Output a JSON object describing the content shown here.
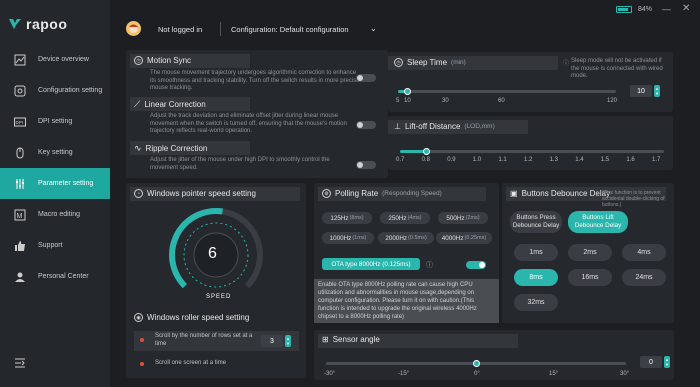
{
  "app": {
    "name": "rapoo",
    "battery": "84%",
    "battery_level": 0.84
  },
  "colors": {
    "accent": "#2ab6ad",
    "sidebar_bg": "#24272b",
    "panel_bg": "#2b2e33"
  },
  "sidebar": {
    "items": [
      {
        "label": "Device overview",
        "icon": "chart-icon"
      },
      {
        "label": "Configuration setting",
        "icon": "config-icon"
      },
      {
        "label": "DPI setting",
        "icon": "dpi-icon"
      },
      {
        "label": "Key setting",
        "icon": "mouse-icon"
      },
      {
        "label": "Parameter setting",
        "icon": "sliders-icon"
      },
      {
        "label": "Macro editing",
        "icon": "macro-icon"
      },
      {
        "label": "Support",
        "icon": "thumbs-up-icon"
      },
      {
        "label": "Personal Center",
        "icon": "user-icon"
      }
    ],
    "active_index": 4
  },
  "header": {
    "login": "Not logged in",
    "configuration": "Configuration: Default configuration"
  },
  "motion_sync": {
    "title": "Motion Sync",
    "desc": "The mouse movement trajectory undergoes algorithmic correction to enhance its smoothness and tracking stability. Turn off the switch results in more precise mouse tracking.",
    "enabled": false
  },
  "linear_correction": {
    "title": "Linear Correction",
    "desc": "Adjust the track deviation and eliminate offset jitter during linear mouse movement when the switch is turned off, ensuring that the mouse's motion trajectory reflects real-world operation.",
    "enabled": false
  },
  "ripple_correction": {
    "title": "Ripple Correction",
    "desc": "Adjust the jitter of the mouse under high DPI to smoothly control the movement speed.",
    "enabled": false
  },
  "sleep_time": {
    "title": "Sleep Time",
    "unit": "(min)",
    "note": "Sleep mode will not be activated if the mouse is connected with wired mode.",
    "value": "10",
    "ticks": [
      "5",
      "10",
      "30",
      "60",
      "120"
    ],
    "fraction": 0.04
  },
  "liftoff": {
    "title": "Lift-off Distance",
    "unit": "(LOD,mm)",
    "ticks": [
      "0.7",
      "0.8",
      "0.9",
      "1.0",
      "1.1",
      "1.2",
      "1.3",
      "1.4",
      "1.5",
      "1.6",
      "1.7"
    ],
    "value": 0.8
  },
  "pointer_speed": {
    "title": "Windows pointer speed setting",
    "value": "6",
    "label": "SPEED"
  },
  "polling": {
    "title": "Polling Rate",
    "subtitle": "(Responding Speed)",
    "options": [
      {
        "hz": "125Hz",
        "ms": "(8ms)"
      },
      {
        "hz": "250Hz",
        "ms": "(4ms)"
      },
      {
        "hz": "500Hz",
        "ms": "(2ms)"
      },
      {
        "hz": "1000Hz",
        "ms": "(1ms)"
      },
      {
        "hz": "2000Hz",
        "ms": "(0.5ms)"
      },
      {
        "hz": "4000Hz",
        "ms": "(0.25ms)"
      }
    ],
    "ota_label": "OTA type 8000Hz (0.125ms)",
    "ota_enabled": true,
    "tooltip": "Enable OTA type 8000Hz polling rate can cause high CPU utilization and abnormalities in mouse usage,depending on computer configuration. Please turn it on with caution.(This function is intended to upgrade the original wireless 4000Hz chipset to a 8000Hz polling rate)"
  },
  "debounce": {
    "title": "Buttons Debounce Delay",
    "subtitle": "(This function is to prevent accidental double-clicking of buttons.)",
    "tab_press": "Buttons Press Debounce Delay",
    "tab_lift": "Buttons Lift Debounce Delay",
    "options": [
      "1ms",
      "2ms",
      "4ms",
      "8ms",
      "16ms",
      "24ms",
      "32ms"
    ],
    "active_index": 3
  },
  "roller": {
    "title": "Windows roller speed setting",
    "option1": "Scroll by the number of rows set at a time",
    "option2": "Scroll one screen at a time",
    "value": "3"
  },
  "sensor_angle": {
    "title": "Sensor angle",
    "value": "0",
    "ticks": [
      "-30°",
      "-15°",
      "0°",
      "15°",
      "30°"
    ],
    "fraction": 0.5
  }
}
